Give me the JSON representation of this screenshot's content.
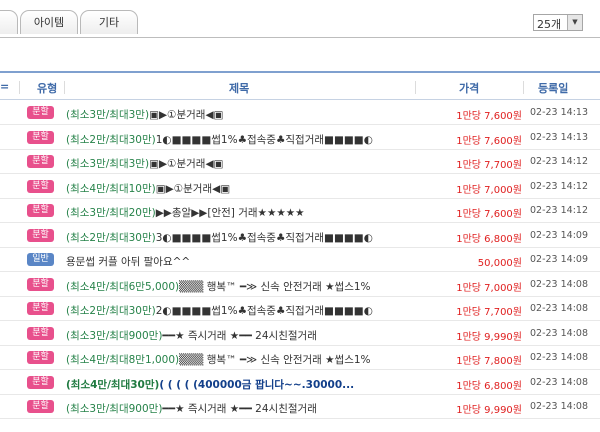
{
  "tabs": {
    "items": "아이템",
    "other": "기타"
  },
  "page_size": {
    "selected": "25개"
  },
  "table": {
    "headers": {
      "sort": "=",
      "type": "유형",
      "title": "제목",
      "price": "가격",
      "date": "등록일"
    },
    "rows": [
      {
        "lead": "",
        "type": "분할",
        "cond": "(최소3만/최대3만)",
        "rest": "▣▶①분거래◀▣",
        "price": "1만당 7,600원",
        "date": "02-23 14:13"
      },
      {
        "lead": "",
        "type": "분할",
        "cond": "(최소2만/최대30만)",
        "rest": "1◐■■■■썹1%♣접속중♣직접거래■■■■◐",
        "price": "1만당 7,600원",
        "date": "02-23 14:13"
      },
      {
        "lead": "",
        "type": "분할",
        "cond": "(최소3만/최대3만)",
        "rest": "▣▶①분거래◀▣",
        "price": "1만당 7,700원",
        "date": "02-23 14:12"
      },
      {
        "lead": "",
        "type": "분할",
        "cond": "(최소4만/최대10만)",
        "rest": "▣▶①분거래◀▣",
        "price": "1만당 7,000원",
        "date": "02-23 14:12"
      },
      {
        "lead": "",
        "type": "분할",
        "cond": "(최소3만/최대20만)",
        "rest": "▶▶총알▶▶[안전] 거래★★★★★",
        "price": "1만당 7,600원",
        "date": "02-23 14:12"
      },
      {
        "lead": "",
        "type": "분할",
        "cond": "(최소2만/최대30만)",
        "rest": "3◐■■■■썹1%♣접속중♣직접거래■■■■◐",
        "price": "1만당 6,800원",
        "date": "02-23 14:09"
      },
      {
        "lead": "썹",
        "type": "일반",
        "cond": "",
        "rest": "용문썹 커플 아뒤 팔아요^^",
        "price": "50,000원",
        "date": "02-23 14:09"
      },
      {
        "lead": "",
        "type": "분할",
        "cond": "(최소4만/최대6만5,000)",
        "rest": "▒▒▒ 행복™ ━≫ 신속 안전거래 ★썹스1%",
        "price": "1만당 7,000원",
        "date": "02-23 14:08"
      },
      {
        "lead": "",
        "type": "분할",
        "cond": "(최소2만/최대30만)",
        "rest": "2◐■■■■썹1%♣접속중♣직접거래■■■■◐",
        "price": "1만당 7,700원",
        "date": "02-23 14:08"
      },
      {
        "lead": "",
        "type": "분할",
        "cond": "(최소3만/최대900만)",
        "rest": "━━★ 즉시거래 ★━━ 24시친절거래",
        "price": "1만당 9,990원",
        "date": "02-23 14:08"
      },
      {
        "lead": "",
        "type": "분할",
        "cond": "(최소4만/최대8만1,000)",
        "rest": "▒▒▒ 행복™ ━≫ 신속 안전거래 ★썹스1%",
        "price": "1만당 7,800원",
        "date": "02-23 14:08"
      },
      {
        "lead": "",
        "type": "분할",
        "cond": "(최소4만/최대30만)",
        "rest": "( ( ( ( (400000금 팝니다~~.30000...",
        "price": "1만당 6,800원",
        "date": "02-23 14:08",
        "bold": true
      },
      {
        "lead": "",
        "type": "분할",
        "cond": "(최소3만/최대900만)",
        "rest": "━━★ 즉시거래 ★━━ 24시친절거래",
        "price": "1만당 9,990원",
        "date": "02-23 14:08"
      }
    ]
  }
}
